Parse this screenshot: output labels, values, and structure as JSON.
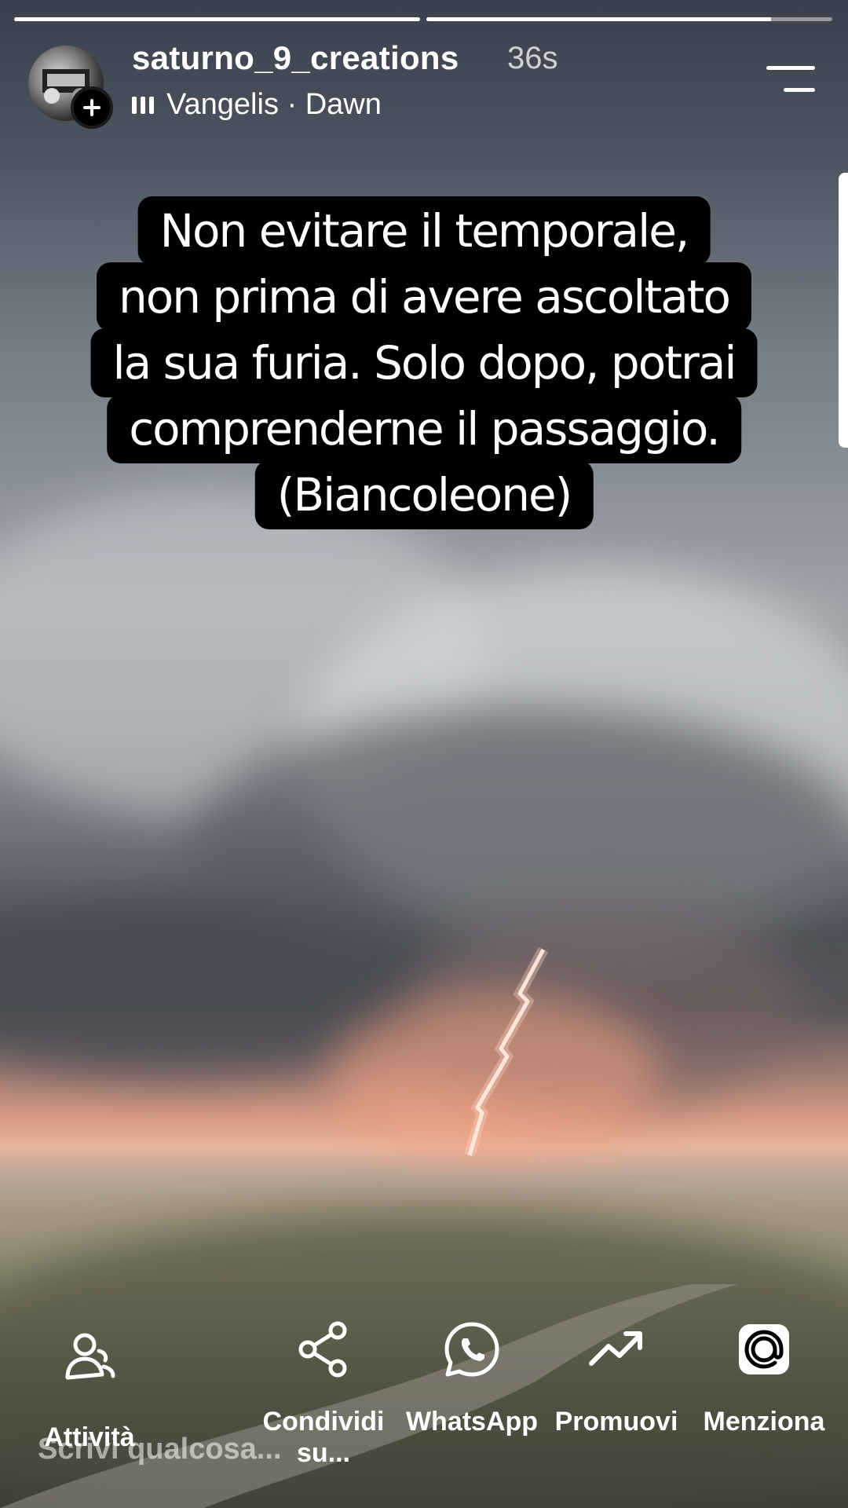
{
  "story": {
    "progress": [
      1.0,
      0.85
    ],
    "username": "saturno_9_creations",
    "time_ago": "36s",
    "music": {
      "icon": "music-bars-icon",
      "label": "Vangelis · Dawn"
    },
    "quote_lines": [
      "Non evitare il temporale,",
      "non prima di avere ascoltato",
      "la sua furia. Solo dopo, potrai",
      "comprenderne il passaggio.",
      "(Biancoleone)"
    ]
  },
  "actions": [
    {
      "icon": "activity-people-icon",
      "label": "Attività"
    },
    {
      "icon": "share-icon",
      "label": "Condividi su..."
    },
    {
      "icon": "whatsapp-icon",
      "label": "WhatsApp"
    },
    {
      "icon": "trending-up-icon",
      "label": "Promuovi"
    },
    {
      "icon": "at-mention-icon",
      "label": "Menziona"
    }
  ],
  "compose_placeholder": "Scrivi qualcosa..."
}
